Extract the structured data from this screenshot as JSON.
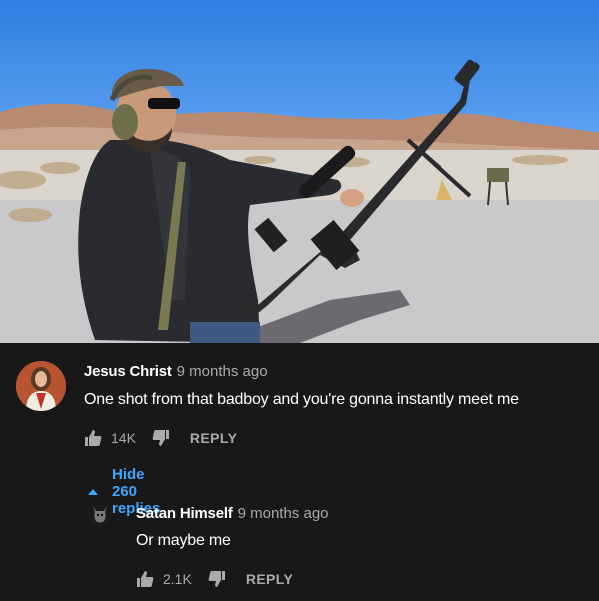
{
  "photo": {
    "description_icon": "rifle-photo"
  },
  "comment": {
    "author": "Jesus Christ",
    "time": "9 months ago",
    "text": "One shot from that badboy and you're gonna instantly meet me",
    "likes": "14K",
    "reply_label": "REPLY",
    "toggle_label": "Hide 260 replies"
  },
  "reply": {
    "author": "Satan Himself",
    "time": "9 months ago",
    "text": "Or maybe me",
    "likes": "2.1K",
    "reply_label": "REPLY"
  },
  "colors": {
    "background": "#181818",
    "link": "#3ea6ff",
    "muted": "#aaaaaa"
  }
}
